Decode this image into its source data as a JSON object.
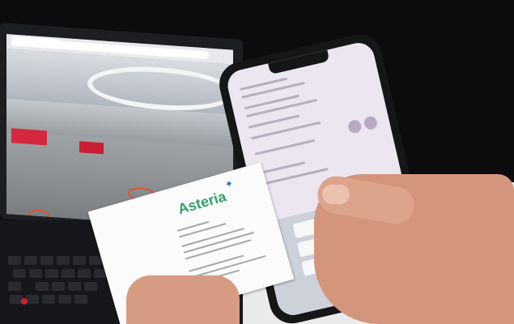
{
  "scene": {
    "description_tag": "photo"
  },
  "business_card": {
    "brand_name": "Asteria"
  },
  "colors": {
    "brand_green": "#2fa36b",
    "hotspot_orange": "#e4502e",
    "banner_red": "#d5283c"
  }
}
